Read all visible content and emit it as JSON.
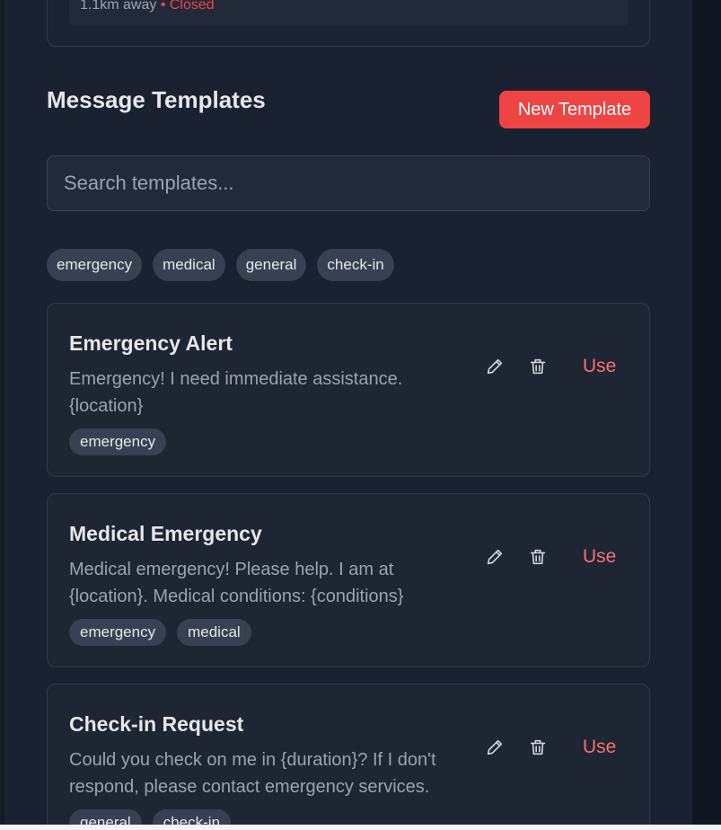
{
  "previous_card": {
    "distance": "1.1km away",
    "separator": " • ",
    "status": "Closed"
  },
  "section": {
    "title": "Message Templates",
    "new_button": "New Template"
  },
  "search": {
    "placeholder": "Search templates...",
    "value": ""
  },
  "filters": [
    "emergency",
    "medical",
    "general",
    "check-in"
  ],
  "templates": [
    {
      "title": "Emergency Alert",
      "body": "Emergency! I need immediate assistance. {location}",
      "tags": [
        "emergency"
      ]
    },
    {
      "title": "Medical Emergency",
      "body": "Medical emergency! Please help. I am at {location}. Medical conditions: {conditions}",
      "tags": [
        "emergency",
        "medical"
      ]
    },
    {
      "title": "Check-in Request",
      "body": "Could you check on me in {duration}? If I don't respond, please contact emergency services.",
      "tags": [
        "general",
        "check-in"
      ]
    }
  ],
  "actions": {
    "edit_icon": "pencil-icon",
    "delete_icon": "trash-icon",
    "use_label": "Use"
  },
  "colors": {
    "accent": "#ef4444",
    "use_text": "#f87171",
    "background": "#1a2130",
    "card": "#1e2533",
    "chip": "#374151"
  }
}
